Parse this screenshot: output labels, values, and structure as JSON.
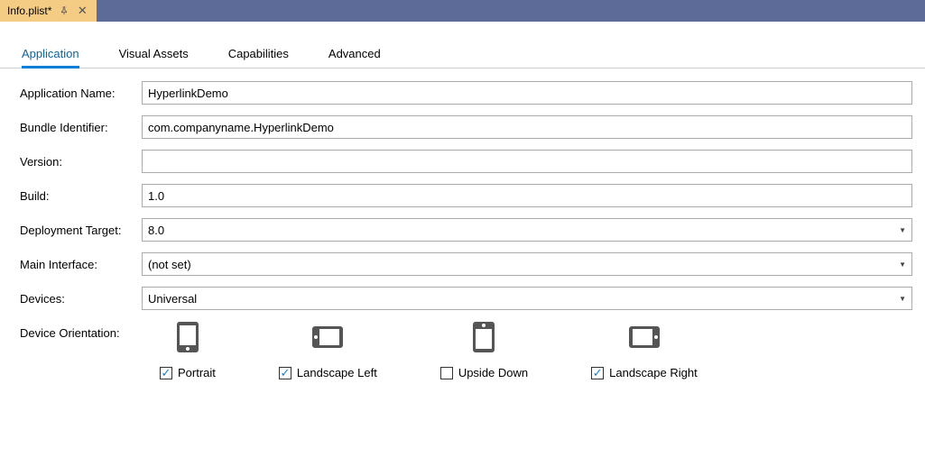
{
  "titlebar": {
    "tab_name": "Info.plist*"
  },
  "tabs": [
    "Application",
    "Visual Assets",
    "Capabilities",
    "Advanced"
  ],
  "labels": {
    "app_name": "Application Name:",
    "bundle_id": "Bundle Identifier:",
    "version": "Version:",
    "build": "Build:",
    "deploy": "Deployment Target:",
    "main_if": "Main Interface:",
    "devices": "Devices:",
    "orient": "Device Orientation:"
  },
  "values": {
    "app_name": "HyperlinkDemo",
    "bundle_id": "com.companyname.HyperlinkDemo",
    "version": "",
    "build": "1.0",
    "deploy": "8.0",
    "main_if": "(not set)",
    "devices": "Universal"
  },
  "orientations": [
    {
      "label": "Portrait",
      "checked": true
    },
    {
      "label": "Landscape Left",
      "checked": true
    },
    {
      "label": "Upside Down",
      "checked": false
    },
    {
      "label": "Landscape Right",
      "checked": true
    }
  ]
}
